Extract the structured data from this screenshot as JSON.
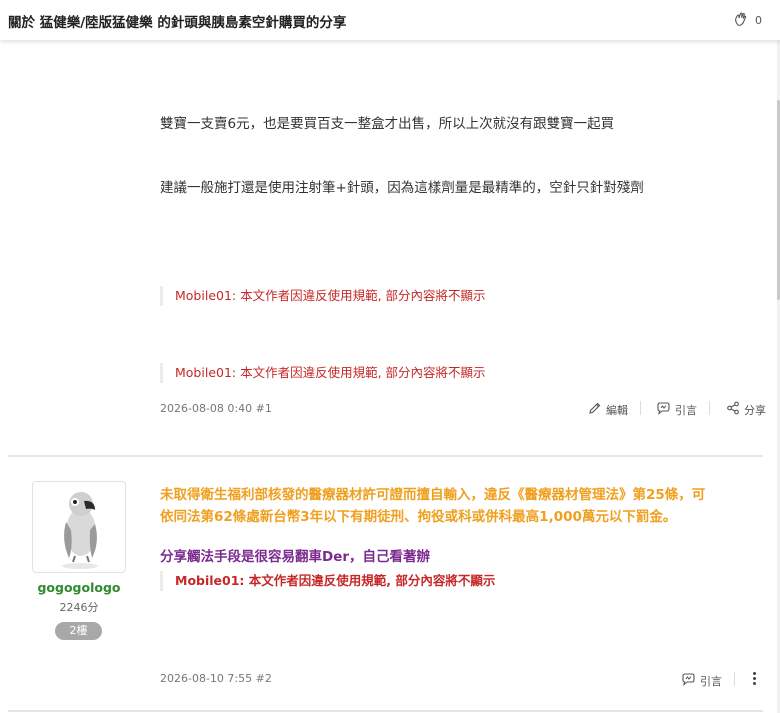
{
  "header": {
    "title": "關於 猛健樂/陸版猛健樂 的針頭與胰島素空針購買的分享",
    "like_count": "0"
  },
  "post1": {
    "paragraphs": [
      "雙寶一支賣6元，也是要買百支一整盒才出售，所以上次就沒有跟雙寶一起買",
      "建議一般施打還是使用注射筆+針頭，因為這樣劑量是最精準的，空針只針對殘劑"
    ],
    "notices": [
      "Mobile01: 本文作者因違反使用規範, 部分內容將不顯示",
      "Mobile01: 本文作者因違反使用規範, 部分內容將不顯示"
    ],
    "meta": "2026-08-08 0:40 #1",
    "actions": {
      "edit": "編輯",
      "quote": "引言",
      "share": "分享"
    }
  },
  "post2": {
    "user": {
      "name": "gogogologo",
      "score": "2246分",
      "floor": "2樓"
    },
    "warning_lines": [
      "未取得衛生福利部核發的醫療器材許可證而擅自輸入，違反《醫療器材管理法》第25條，可",
      "依同法第62條處新台幣3年以下有期徒刑、拘役或科或併科最高1,000萬元以下罰金。"
    ],
    "purple_text": "分享觸法手段是很容易翻車Der，自己看著辦",
    "notice": "Mobile01: 本文作者因違反使用規範, 部分內容將不顯示",
    "meta": "2026-08-10 7:55 #2",
    "actions": {
      "quote": "引言"
    }
  },
  "colors": {
    "notice_red": "#c62828",
    "warning_orange": "#f0a020",
    "purple": "#7b2a8f",
    "username_green": "#2e8b2e"
  },
  "icons": [
    "clap-icon",
    "pencil-icon",
    "quote-icon",
    "share-icon",
    "more-vertical-icon",
    "parrot-avatar"
  ]
}
